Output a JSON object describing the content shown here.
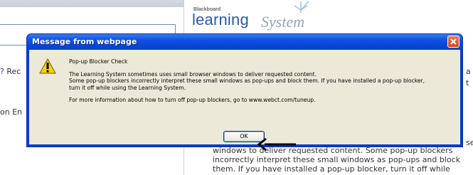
{
  "background": {
    "help_link_prefix": "?",
    "help_text": " Rec",
    "env_text": "on En",
    "logo_brand": "Blackboard",
    "logo_learning": "learning",
    "logo_system": "System",
    "right_cutoff_a": "a",
    "right_cutoff_t": "t",
    "right_cutoff_ser": "ser",
    "paragraph_lines": [
      "windows to deliver requested content. Some pop-up blockers",
      "incorrectly interpret these small windows as pop-ups and block",
      "them. If you have installed a pop-up blocker, turn it off while"
    ]
  },
  "dialog": {
    "title": "Message from webpage",
    "icon": "warning-icon",
    "heading": "Pop-up Blocker Check",
    "paragraph1_lines": [
      "The Learning System sometimes uses small browser windows to deliver requested content.",
      "Some pop-up blockers incorrectly interpret these small windows as pop-ups and block them. If you have installed a pop-up blocker,",
      "turn it off while using the Learning System."
    ],
    "paragraph2": "For more information about how to turn off pop-up blockers, go to www.webct.com/tuneup.",
    "ok_label": "OK",
    "close_icon": "close-icon"
  },
  "annotation": {
    "arrow_icon": "left-arrow-icon"
  },
  "colors": {
    "titlebar": "#0a46d8",
    "client": "#ece9d8",
    "close": "#d5421c",
    "logo_blue": "#2a5aa8"
  }
}
